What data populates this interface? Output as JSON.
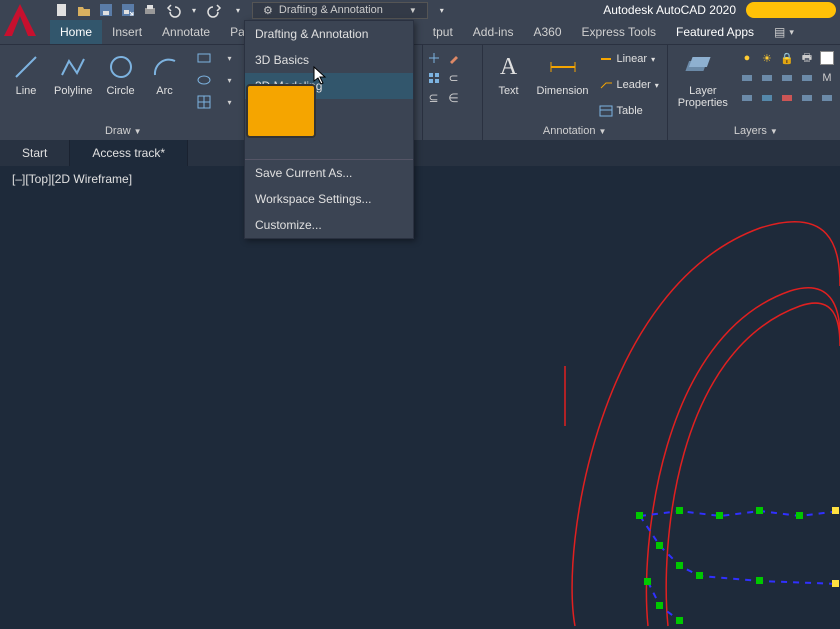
{
  "app": {
    "title": "Autodesk AutoCAD 2020"
  },
  "workspace": {
    "current": "Drafting & Annotation",
    "items": [
      "Drafting & Annotation",
      "3D Basics",
      "3D Modeling"
    ],
    "footer": [
      "Save Current As...",
      "Workspace Settings...",
      "Customize..."
    ]
  },
  "ribbonTabs": [
    "Home",
    "Insert",
    "Annotate",
    "Pa",
    "tput",
    "Add-ins",
    "A360",
    "Express Tools",
    "Featured Apps"
  ],
  "draw": {
    "title": "Draw",
    "buttons": {
      "line": "Line",
      "polyline": "Polyline",
      "circle": "Circle",
      "arc": "Arc"
    }
  },
  "annotation": {
    "title": "Annotation",
    "text": "Text",
    "dimension": "Dimension",
    "linear": "Linear",
    "leader": "Leader",
    "table": "Table"
  },
  "layers": {
    "title": "Layers",
    "props": "Layer\nProperties"
  },
  "fileTabs": {
    "start": "Start",
    "active": "Access track*"
  },
  "viewportLabel": "[–][Top][2D Wireframe]",
  "colors": {
    "accent": "#f5a500",
    "bg": "#1e2a3a",
    "panel": "#3b4453",
    "hover": "#32566c"
  }
}
